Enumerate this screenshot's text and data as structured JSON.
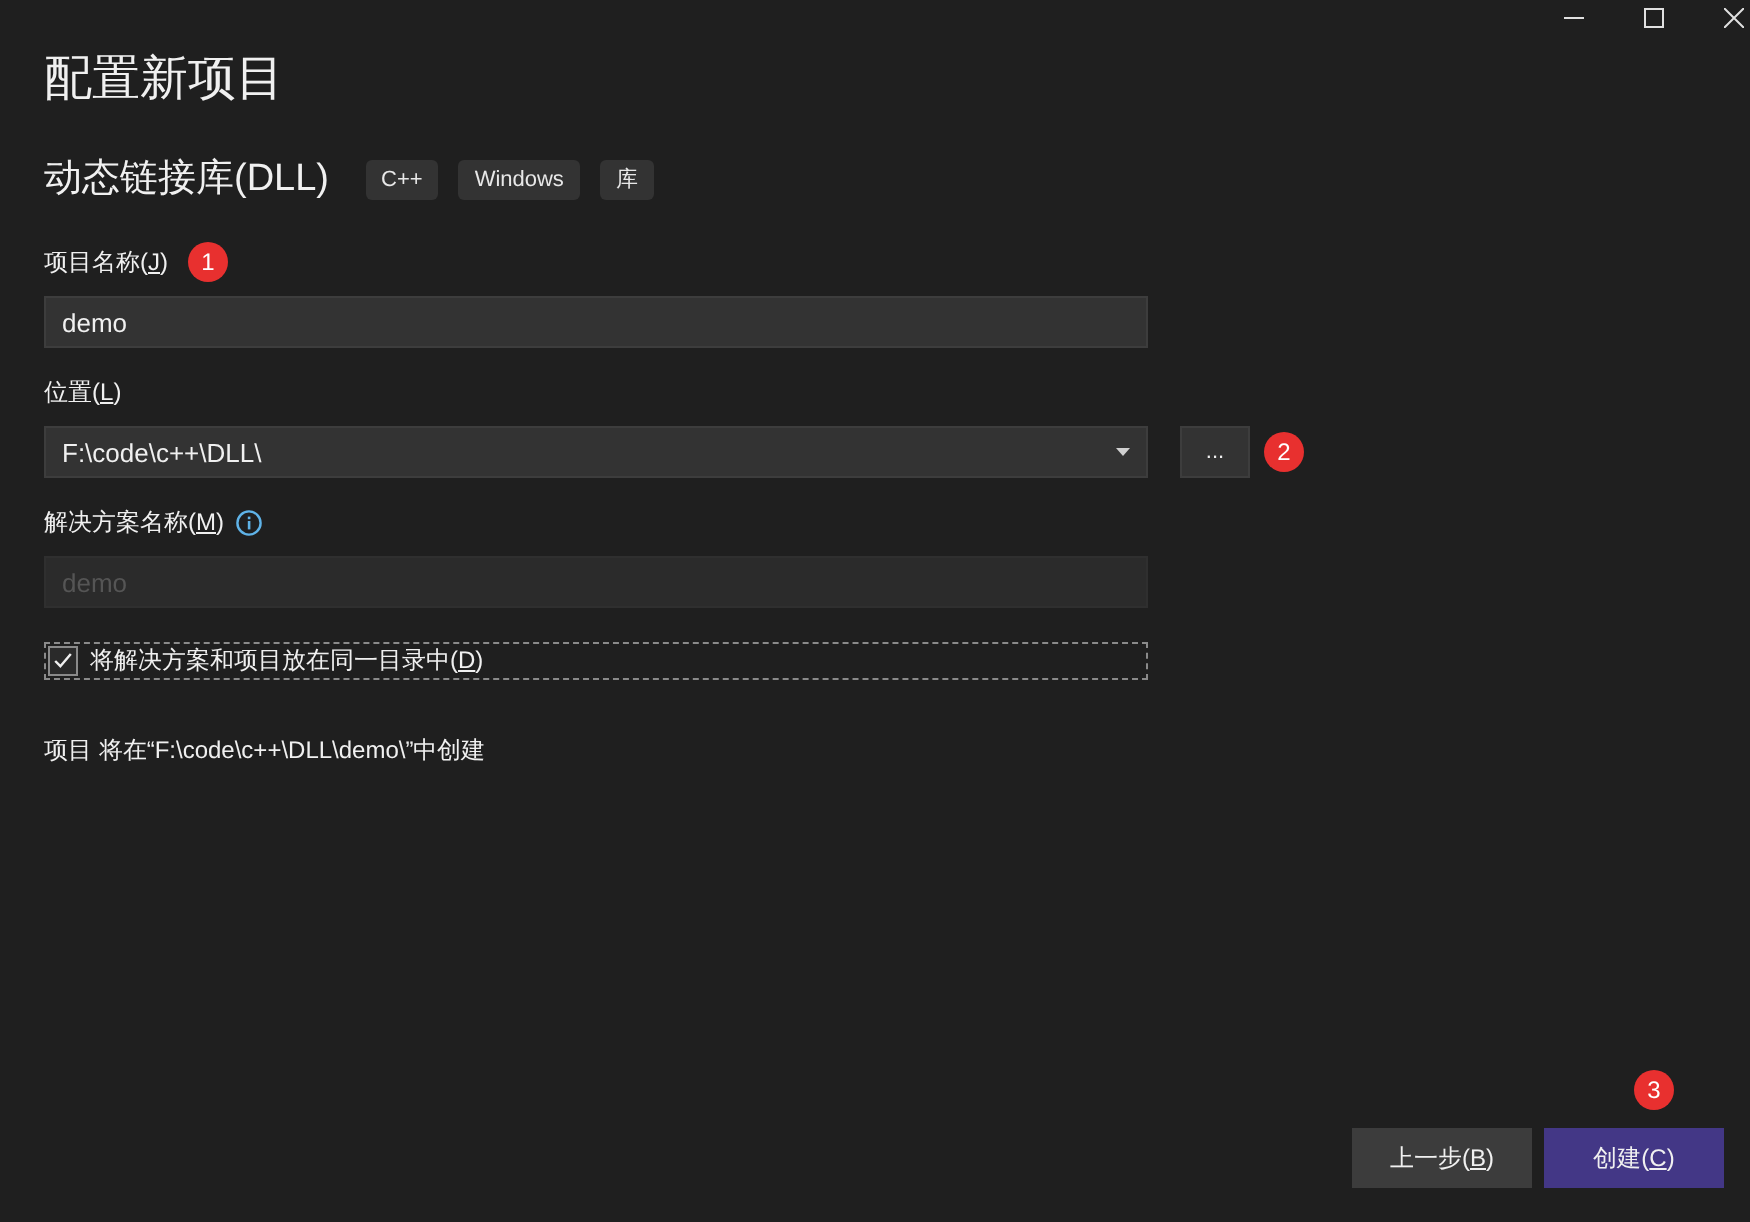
{
  "window": {
    "title": "配置新项目"
  },
  "template": {
    "name": "动态链接库(DLL)",
    "tags": [
      "C++",
      "Windows",
      "库"
    ]
  },
  "fields": [
    {
      "kind": "text",
      "label": "项目名称(",
      "access_key": "J",
      "label_end": ")",
      "marker": "1",
      "value": "demo",
      "disabled": false
    },
    {
      "kind": "dropdown",
      "label": "位置(",
      "access_key": "L",
      "label_end": ")",
      "value": "F:\\code\\c++\\DLL\\",
      "browse": {
        "label": "...",
        "marker": "2"
      }
    },
    {
      "kind": "text",
      "label": "解决方案名称(",
      "access_key": "M",
      "label_end": ")",
      "info": true,
      "value": "demo",
      "disabled": true
    }
  ],
  "same_directory": {
    "label": "将解决方案和项目放在同一目录中(",
    "access_key": "D",
    "label_end": ")",
    "checked": true,
    "focused": true
  },
  "location_note": "项目 将在“F:\\code\\c++\\DLL\\demo\\”中创建",
  "buttons": [
    {
      "label": "上一步(",
      "access_key": "B",
      "label_end": ")",
      "primary": false
    },
    {
      "label": "创建(",
      "access_key": "C",
      "label_end": ")",
      "primary": true,
      "marker": "3"
    }
  ]
}
